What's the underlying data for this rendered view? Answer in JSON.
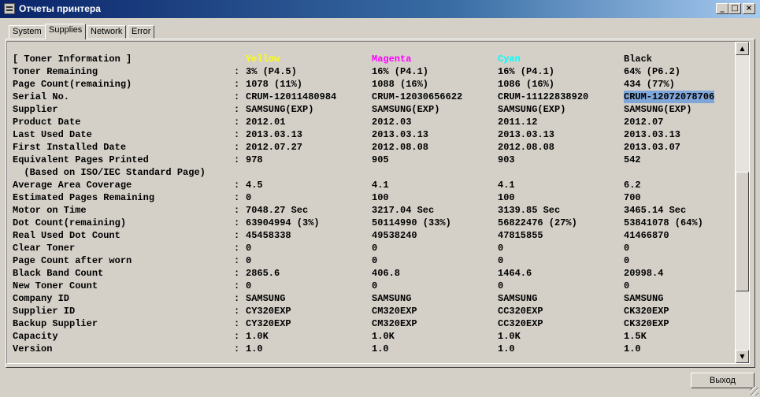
{
  "window": {
    "title": "Отчеты принтера",
    "minimize_glyph": "_",
    "maximize_glyph": "□",
    "close_glyph": "×"
  },
  "tabs": [
    {
      "label": "System",
      "active": false
    },
    {
      "label": "Supplies",
      "active": true
    },
    {
      "label": "Network",
      "active": false
    },
    {
      "label": "Error",
      "active": false
    }
  ],
  "colors": {
    "yellow": "#ffff00",
    "magenta": "#ff00ff",
    "cyan": "#00ffff",
    "selection": "#7fa6d9"
  },
  "toner": {
    "section_title": "[ Toner Information ]",
    "columns": [
      "Yellow",
      "Magenta",
      "Cyan",
      "Black"
    ],
    "rows": [
      {
        "label": "Toner Remaining",
        "sep": ":",
        "values": [
          "3% (P4.5)",
          "16% (P4.1)",
          "16% (P4.1)",
          "64% (P6.2)"
        ]
      },
      {
        "label": "Page Count(remaining)",
        "sep": ":",
        "values": [
          "1078 (11%)",
          "1088 (16%)",
          "1086 (16%)",
          "434 (77%)"
        ]
      },
      {
        "label": "Serial No.",
        "sep": ":",
        "values": [
          "CRUM-12011480984",
          "CRUM-12030656622",
          "CRUM-11122838920",
          "CRUM-12072078706"
        ]
      },
      {
        "label": "Supplier",
        "sep": ":",
        "values": [
          "SAMSUNG(EXP)",
          "SAMSUNG(EXP)",
          "SAMSUNG(EXP)",
          "SAMSUNG(EXP)"
        ]
      },
      {
        "label": "Product Date",
        "sep": ":",
        "values": [
          "2012.01",
          "2012.03",
          "2011.12",
          "2012.07"
        ]
      },
      {
        "label": "Last Used Date",
        "sep": ":",
        "values": [
          "2013.03.13",
          "2013.03.13",
          "2013.03.13",
          "2013.03.13"
        ]
      },
      {
        "label": "First Installed Date",
        "sep": ":",
        "values": [
          "2012.07.27",
          "2012.08.08",
          "2012.08.08",
          "2013.03.07"
        ]
      },
      {
        "label": "Equivalent Pages Printed",
        "sep": ":",
        "values": [
          "978",
          "905",
          "903",
          "542"
        ]
      },
      {
        "label": "  (Based on ISO/IEC Standard Page)",
        "sep": "",
        "values": [
          "",
          "",
          "",
          ""
        ]
      },
      {
        "label": "Average Area Coverage",
        "sep": ":",
        "values": [
          "4.5",
          "4.1",
          "4.1",
          "6.2"
        ]
      },
      {
        "label": "Estimated Pages Remaining",
        "sep": ":",
        "values": [
          "0",
          "100",
          "100",
          "700"
        ]
      },
      {
        "label": "Motor on Time",
        "sep": ":",
        "values": [
          "7048.27 Sec",
          "3217.04 Sec",
          "3139.85 Sec",
          "3465.14 Sec"
        ]
      },
      {
        "label": "Dot Count(remaining)",
        "sep": ":",
        "values": [
          "63904994 (3%)",
          "50114990 (33%)",
          "56822476 (27%)",
          "53841078 (64%)"
        ]
      },
      {
        "label": "Real Used Dot Count",
        "sep": ":",
        "values": [
          "45458338",
          "49538240",
          "47815855",
          "41466870"
        ]
      },
      {
        "label": "Clear Toner",
        "sep": ":",
        "values": [
          "0",
          "0",
          "0",
          "0"
        ]
      },
      {
        "label": "Page Count after worn",
        "sep": ":",
        "values": [
          "0",
          "0",
          "0",
          "0"
        ]
      },
      {
        "label": "Black Band Count",
        "sep": ":",
        "values": [
          "2865.6",
          "406.8",
          "1464.6",
          "20998.4"
        ]
      },
      {
        "label": "New Toner Count",
        "sep": ":",
        "values": [
          "0",
          "0",
          "0",
          "0"
        ]
      },
      {
        "label": "Company ID",
        "sep": ":",
        "values": [
          "SAMSUNG",
          "SAMSUNG",
          "SAMSUNG",
          "SAMSUNG"
        ]
      },
      {
        "label": "Supplier ID",
        "sep": ":",
        "values": [
          "CY320EXP",
          "CM320EXP",
          "CC320EXP",
          "CK320EXP"
        ]
      },
      {
        "label": "Backup Supplier",
        "sep": ":",
        "values": [
          "CY320EXP",
          "CM320EXP",
          "CC320EXP",
          "CK320EXP"
        ]
      },
      {
        "label": "Capacity",
        "sep": ":",
        "values": [
          "1.0K",
          "1.0K",
          "1.0K",
          "1.5K"
        ]
      },
      {
        "label": "Version",
        "sep": ":",
        "values": [
          "1.0",
          "1.0",
          "1.0",
          "1.0"
        ]
      }
    ]
  },
  "scrollbar": {
    "up_glyph": "▲",
    "down_glyph": "▼"
  },
  "exit_button": {
    "label": "Выход"
  }
}
